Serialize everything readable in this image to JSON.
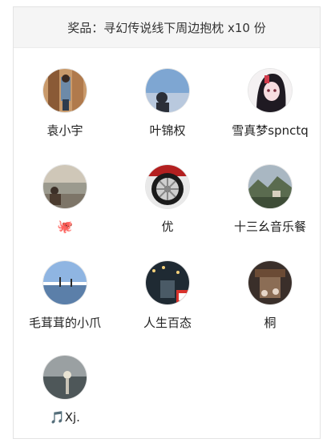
{
  "header": {
    "prize_text": "奖品：寻幻传说线下周边抱枕 x10 份"
  },
  "winners": [
    {
      "name": "袁小宇",
      "avatar": "boy-in-doorway-photo"
    },
    {
      "name": "叶锦权",
      "avatar": "silhouette-against-sky-photo"
    },
    {
      "name": "雪真梦spnctq",
      "avatar": "anime-girl-illustration"
    },
    {
      "name": "🐙",
      "avatar": "person-by-lake-photo"
    },
    {
      "name": "优",
      "avatar": "car-wheel-photo"
    },
    {
      "name": "十三幺音乐餐",
      "avatar": "mountain-landscape-photo"
    },
    {
      "name": "毛茸茸的小爪",
      "avatar": "beach-horizon-photo"
    },
    {
      "name": "人生百态",
      "avatar": "night-street-photo"
    },
    {
      "name": "桐",
      "avatar": "temple-street-photo"
    },
    {
      "name": "🎵Xj.",
      "avatar": "sunset-sea-photo"
    }
  ]
}
